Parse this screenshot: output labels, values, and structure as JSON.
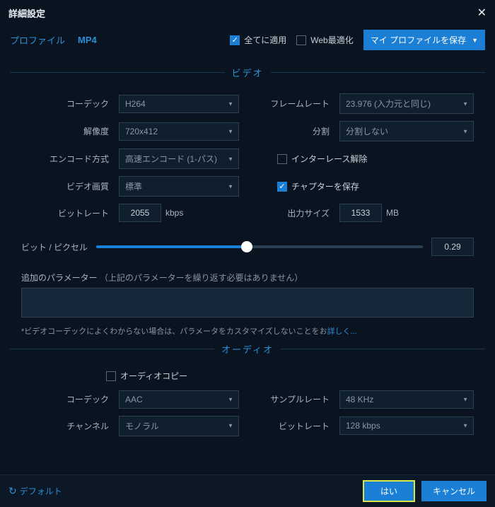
{
  "titlebar": {
    "title": "詳細設定"
  },
  "topbar": {
    "profile_label": "プロファイル",
    "profile_value": "MP4",
    "apply_all": {
      "label": "全てに適用",
      "checked": true
    },
    "web_opt": {
      "label": "Web最適化",
      "checked": false
    },
    "save_profile": "マイ プロファイルを保存"
  },
  "sections": {
    "video": "ビデオ",
    "audio": "オーディオ"
  },
  "video": {
    "codec_label": "コーデック",
    "codec_value": "H264",
    "framerate_label": "フレームレート",
    "framerate_value": "23.976 (入力元と同じ)",
    "res_label": "解像度",
    "res_value": "720x412",
    "split_label": "分割",
    "split_value": "分割しない",
    "encode_label": "エンコード方式",
    "encode_value": "高速エンコード (1-パス)",
    "deinterlace": {
      "label": "インターレース解除",
      "checked": false
    },
    "quality_label": "ビデオ画質",
    "quality_value": "標準",
    "chapter": {
      "label": "チャプターを保存",
      "checked": true
    },
    "bitrate_label": "ビットレート",
    "bitrate_value": "2055",
    "bitrate_unit": "kbps",
    "outsize_label": "出力サイズ",
    "outsize_value": "1533",
    "outsize_unit": "MB",
    "bpp_label": "ビット / ピクセル",
    "bpp_value": "0.29",
    "extra_label": "追加のパラメーター",
    "extra_paren": "（上記のパラメーターを繰り返す必要はありません）",
    "hint_text": "*ビデオコーデックによくわからない場合は、パラメータをカスタマイズしないことをお",
    "hint_link": "詳しく..."
  },
  "audio": {
    "copy": {
      "label": "オーディオコピー",
      "checked": false
    },
    "codec_label": "コーデック",
    "codec_value": "AAC",
    "samplerate_label": "サンプルレート",
    "samplerate_value": "48 KHz",
    "channel_label": "チャンネル",
    "channel_value": "モノラル",
    "bitrate_label": "ビットレート",
    "bitrate_value": "128 kbps"
  },
  "footer": {
    "default": "デフォルト",
    "ok": "はい",
    "cancel": "キャンセル"
  }
}
